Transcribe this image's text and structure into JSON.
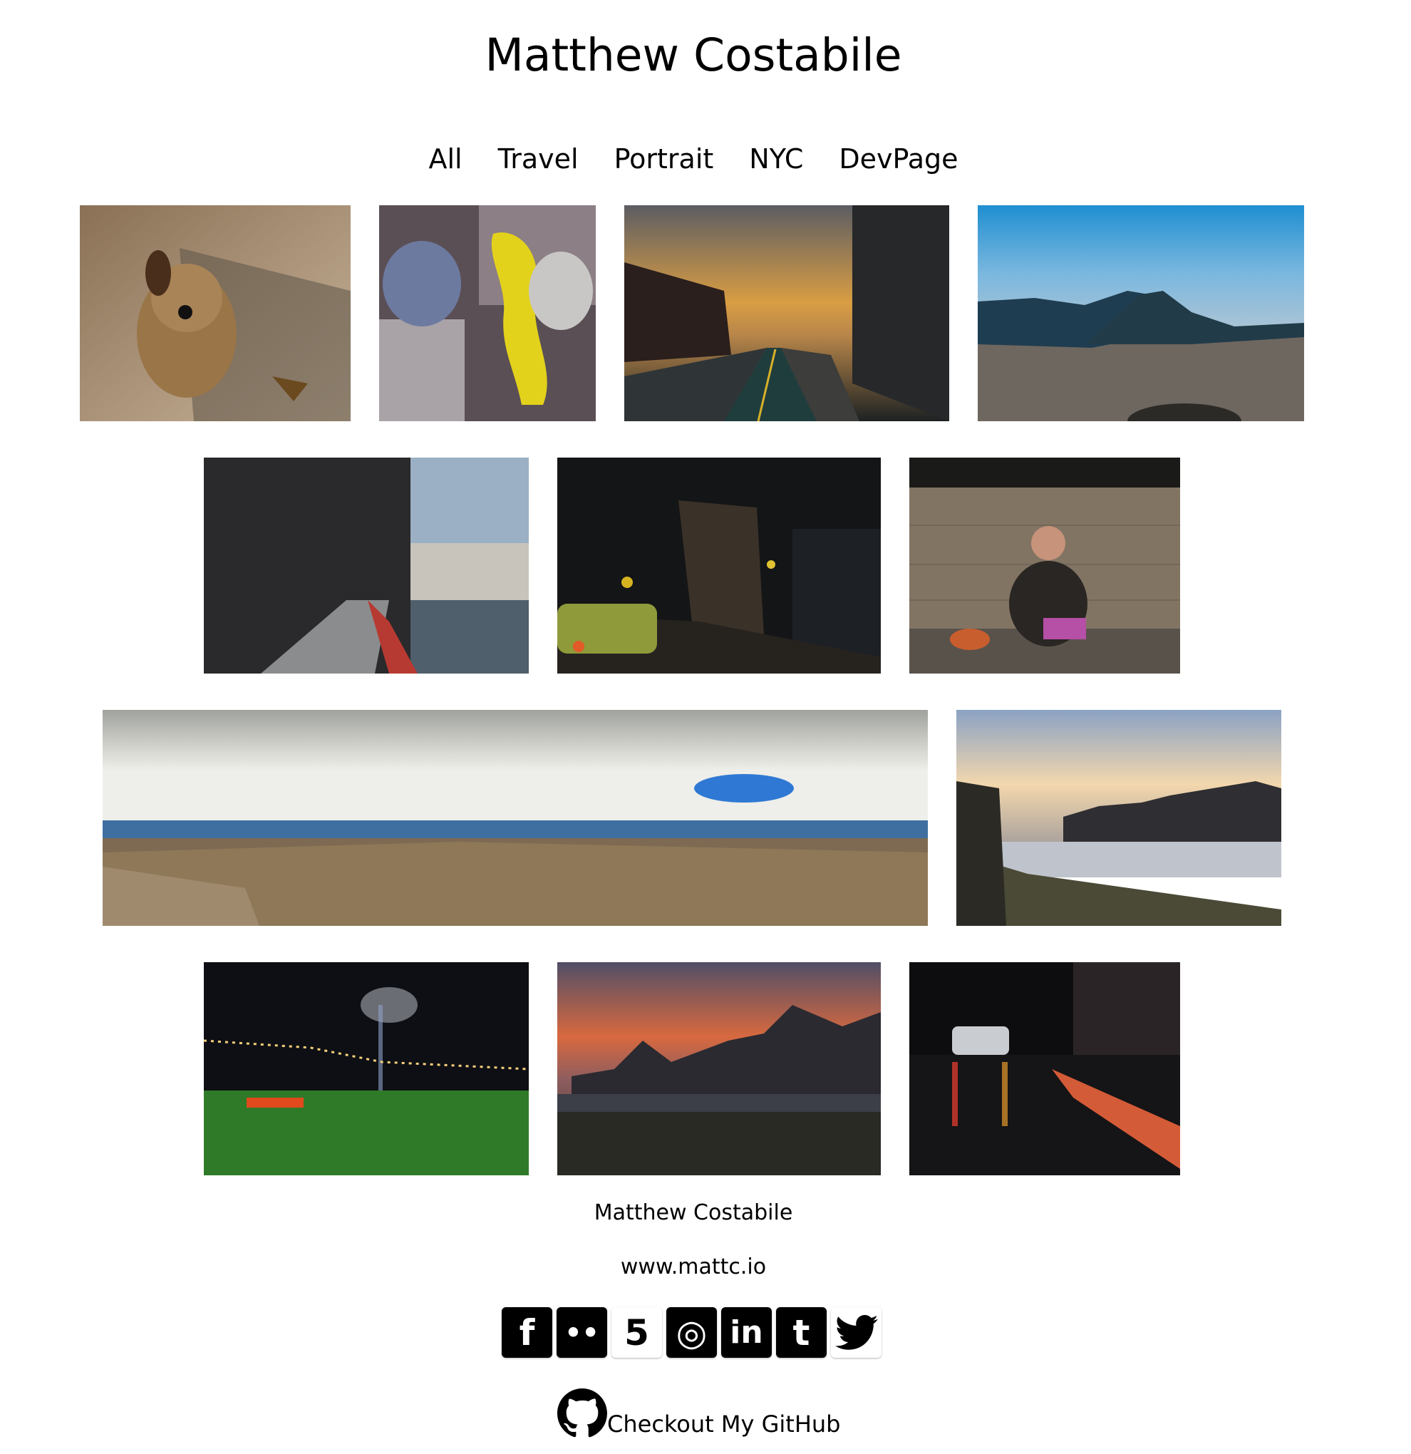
{
  "header": {
    "title": "Matthew Costabile"
  },
  "nav": {
    "items": [
      "All",
      "Travel",
      "Portrait",
      "NYC",
      "DevPage"
    ]
  },
  "gallery": {
    "photos": [
      {
        "name": "photo-dog"
      },
      {
        "name": "photo-holi-color-powder"
      },
      {
        "name": "photo-street-sunset-bike-lane"
      },
      {
        "name": "photo-hudson-river-mountain"
      },
      {
        "name": "photo-waterfront-promenade"
      },
      {
        "name": "photo-night-street-taxi"
      },
      {
        "name": "photo-street-musician"
      },
      {
        "name": "photo-panorama-valley"
      },
      {
        "name": "photo-river-skyline-sunset"
      },
      {
        "name": "photo-brooklyn-bridge-night"
      },
      {
        "name": "photo-skyline-orange-sky"
      },
      {
        "name": "photo-rainy-night-street"
      }
    ]
  },
  "footer": {
    "name": "Matthew Costabile",
    "site": "www.mattc.io",
    "social": [
      {
        "icon": "facebook-icon",
        "glyph": "f"
      },
      {
        "icon": "flickr-icon",
        "glyph": "••"
      },
      {
        "icon": "500px-icon",
        "glyph": "5"
      },
      {
        "icon": "instagram-icon",
        "glyph": "◎"
      },
      {
        "icon": "linkedin-icon",
        "glyph": "in"
      },
      {
        "icon": "tumblr-icon",
        "glyph": "t"
      },
      {
        "icon": "twitter-icon",
        "glyph": "🐦"
      }
    ],
    "github_label": "Checkout My GitHub"
  }
}
